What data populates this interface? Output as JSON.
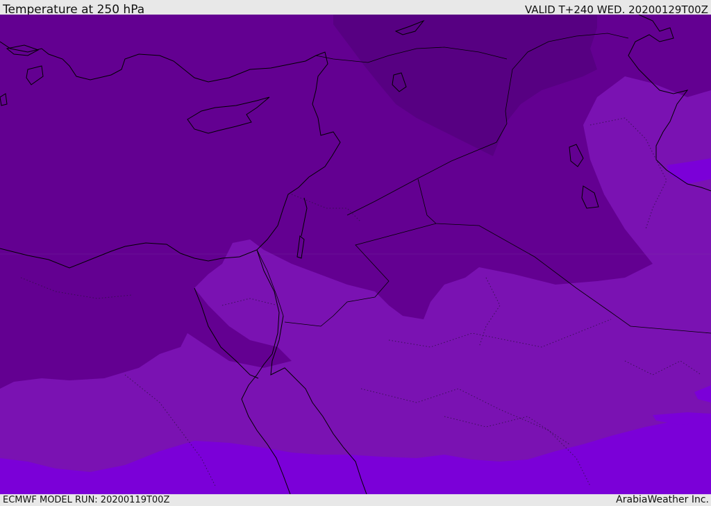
{
  "header": {
    "title": "Temperature at 250 hPa",
    "valid_time": "VALID T+240 WED. 20200129T00Z"
  },
  "footer": {
    "model_run": "ECMWF MODEL RUN: 20200119T00Z",
    "credit": "ArabiaWeather Inc."
  },
  "map": {
    "variable": "Temperature",
    "level": "250 hPa",
    "colors": {
      "darkest": "#570082",
      "dark": "#630091",
      "medium": "#7a12b2",
      "light": "#7b00d8"
    }
  }
}
